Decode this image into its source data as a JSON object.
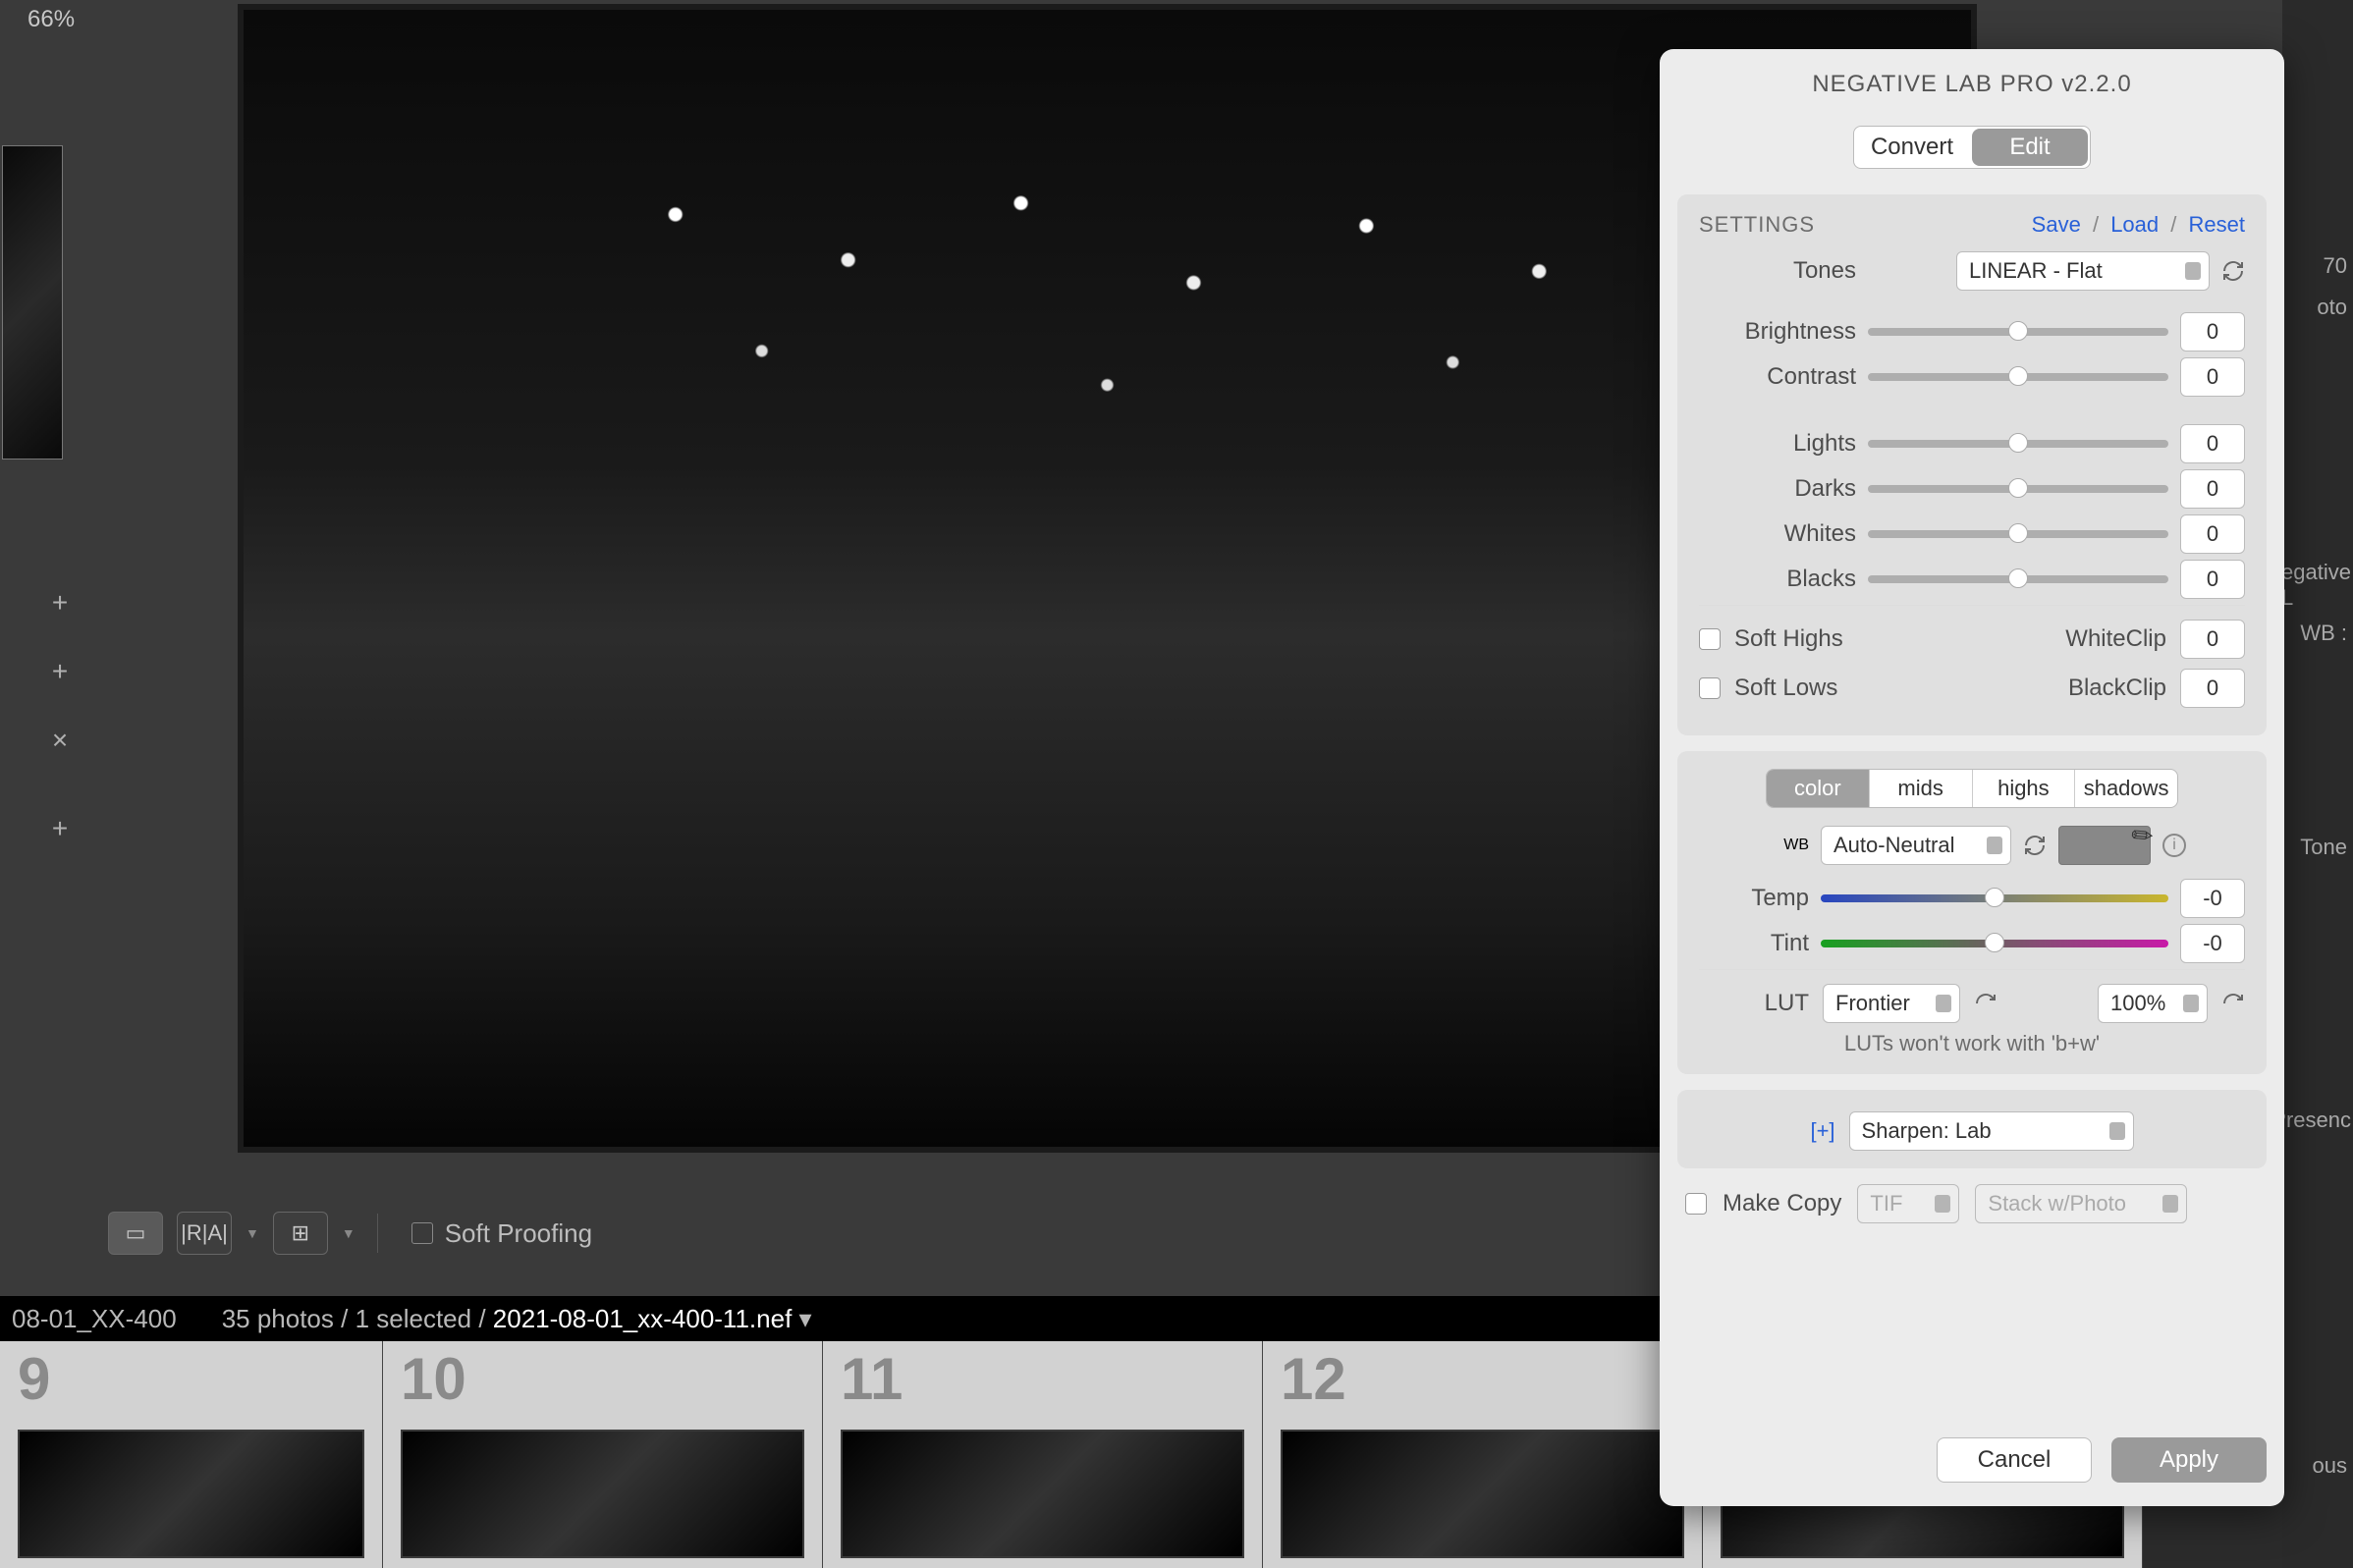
{
  "zoom": "66%",
  "left_icons": [
    "+",
    "+",
    "×",
    "+"
  ],
  "toolbar": {
    "soft_proofing": "Soft Proofing"
  },
  "status": {
    "folder": "08-01_XX-400",
    "count": "35 photos",
    "selected": "1 selected",
    "file": "2021-08-01_xx-400-11.nef"
  },
  "filmstrip": [
    {
      "num": "9"
    },
    {
      "num": "10"
    },
    {
      "num": "11"
    },
    {
      "num": "12"
    }
  ],
  "lr_side": {
    "tab_photo": "oto",
    "tab_negative": "egative L",
    "tab_wb": "WB :",
    "tab_tone": "Tone",
    "tab_presence": "Presenc",
    "tab_previous": "ous",
    "histnum": "70"
  },
  "dialog": {
    "title": "NEGATIVE LAB PRO v2.2.0",
    "tabs": {
      "convert": "Convert",
      "edit": "Edit"
    },
    "settings_label": "SETTINGS",
    "links": {
      "save": "Save",
      "load": "Load",
      "reset": "Reset"
    },
    "tones_label": "Tones",
    "tones_value": "LINEAR - Flat",
    "sliders": {
      "brightness": {
        "label": "Brightness",
        "value": "0"
      },
      "contrast": {
        "label": "Contrast",
        "value": "0"
      },
      "lights": {
        "label": "Lights",
        "value": "0"
      },
      "darks": {
        "label": "Darks",
        "value": "0"
      },
      "whites": {
        "label": "Whites",
        "value": "0"
      },
      "blacks": {
        "label": "Blacks",
        "value": "0"
      }
    },
    "soft_highs": "Soft Highs",
    "soft_lows": "Soft Lows",
    "whiteclip": {
      "label": "WhiteClip",
      "value": "0"
    },
    "blackclip": {
      "label": "BlackClip",
      "value": "0"
    },
    "color_tabs": {
      "color": "color",
      "mids": "mids",
      "highs": "highs",
      "shadows": "shadows"
    },
    "wb_label": "WB",
    "wb_value": "Auto-Neutral",
    "temp": {
      "label": "Temp",
      "value": "-0"
    },
    "tint": {
      "label": "Tint",
      "value": "-0"
    },
    "lut_label": "LUT",
    "lut_value": "Frontier",
    "lut_pct": "100%",
    "lut_note": "LUTs won't work with 'b+w'",
    "add_link": "[+]",
    "sharpen": "Sharpen: Lab",
    "make_copy": "Make Copy",
    "copy_fmt": "TIF",
    "copy_stack": "Stack w/Photo",
    "buttons": {
      "cancel": "Cancel",
      "apply": "Apply"
    }
  }
}
